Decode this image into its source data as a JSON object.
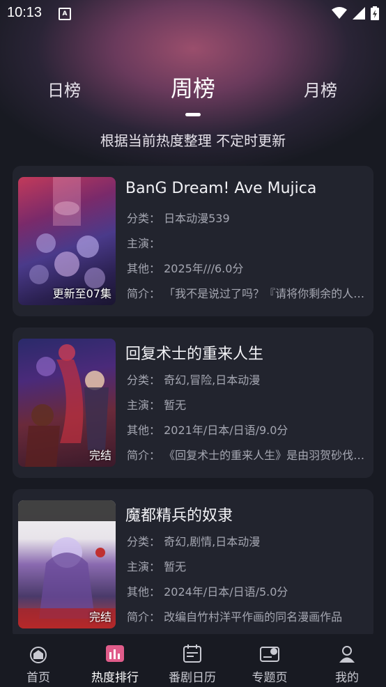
{
  "status": {
    "time": "10:13",
    "indicator": "A"
  },
  "tabs": {
    "daily": "日榜",
    "weekly": "周榜",
    "monthly": "月榜"
  },
  "subtitle": "根据当前热度整理 不定时更新",
  "colors": {
    "background": "#181a22",
    "card": "#22242e",
    "accent": "#ffffff",
    "muted": "#a5a7b2"
  },
  "items": [
    {
      "title": "BanG Dream! Ave Mujica",
      "badge": "更新至07集",
      "category": "分类：  日本动漫539",
      "cast": "主演：",
      "other": "其他：  2025年///6.0分",
      "intro": "简介：  「我不是说过了吗？『请将你剩余的人生交给我』"
    },
    {
      "title": "回复术士的重来人生",
      "badge": "完结",
      "category": "分类：  奇幻,冒险,日本动漫",
      "cast": "主演：  暂无",
      "other": "其他：  2021年/日本/日语/9.0分",
      "intro": "简介：  《回复术士的重来人生》是由羽贺砂伐原作的作品"
    },
    {
      "title": "魔都精兵的奴隶",
      "badge": "完结",
      "category": "分类：  奇幻,剧情,日本动漫",
      "cast": "主演：  暂无",
      "other": "其他：  2024年/日本/日语/5.0分",
      "intro": "简介：  改编自竹村洋平作画的同名漫画作品"
    }
  ],
  "nav": {
    "home": "首页",
    "ranking": "热度排行",
    "calendar": "番剧日历",
    "topics": "专题页",
    "mine": "我的"
  }
}
